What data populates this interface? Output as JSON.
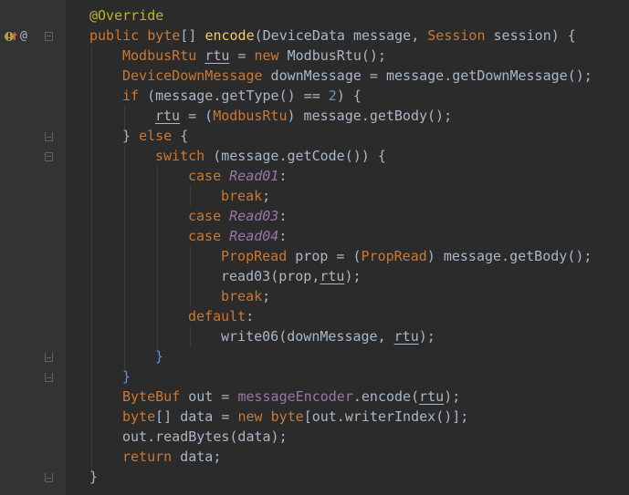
{
  "gutter": {
    "implements_icon": "implements-method-icon",
    "override_icon": "@"
  },
  "code": {
    "l0": {
      "annotation": "@Override"
    },
    "l1": {
      "t1": "public byte",
      "t2": "[] ",
      "t3": "encode",
      "t4": "(DeviceData message, ",
      "t5": "Session",
      "t6": " session) {"
    },
    "l2": {
      "t1": "ModbusRtu",
      "t2": " ",
      "t3": "rtu",
      "t4": " = ",
      "t5": "new",
      "t6": " ModbusRtu",
      "t7": "();"
    },
    "l3": {
      "t1": "DeviceDownMessage",
      "t2": " downMessage = message.",
      "t3": "getDownMessage",
      "t4": "();"
    },
    "l4": {
      "t1": "if",
      "t2": " (message.",
      "t3": "getType",
      "t4": "() == ",
      "t5": "2",
      "t6": ") {"
    },
    "l5": {
      "t1": "rtu",
      "t2": " = (",
      "t3": "ModbusRtu",
      "t4": ") message.",
      "t5": "getBody",
      "t6": "();"
    },
    "l6": {
      "t1": "} ",
      "t2": "else",
      "t3": " {"
    },
    "l7": {
      "t1": "switch",
      "t2": " (message.",
      "t3": "getCode",
      "t4": "()) {"
    },
    "l8": {
      "t1": "case",
      "t2": " ",
      "t3": "Read01",
      "t4": ":"
    },
    "l9": {
      "t1": "break",
      "t2": ";"
    },
    "l10": {
      "t1": "case",
      "t2": " ",
      "t3": "Read03",
      "t4": ":"
    },
    "l11": {
      "t1": "case",
      "t2": " ",
      "t3": "Read04",
      "t4": ":"
    },
    "l12": {
      "t1": "PropRead",
      "t2": " prop = (",
      "t3": "PropRead",
      "t4": ") message.",
      "t5": "getBody",
      "t6": "();"
    },
    "l13": {
      "t1": "read03",
      "t2": "(prop,",
      "t3": "rtu",
      "t4": ");"
    },
    "l14": {
      "t1": "break",
      "t2": ";"
    },
    "l15": {
      "t1": "default",
      "t2": ":"
    },
    "l16": {
      "t1": "write06",
      "t2": "(downMessage, ",
      "t3": "rtu",
      "t4": ");"
    },
    "l17": {
      "t1": "}"
    },
    "l18": {
      "t1": "}"
    },
    "l19": {
      "t1": "ByteBuf",
      "t2": " out = ",
      "t3": "messageEncoder",
      "t4": ".",
      "t5": "encode",
      "t6": "(",
      "t7": "rtu",
      "t8": ");"
    },
    "l20": {
      "t1": "byte",
      "t2": "[] data = ",
      "t3": "new",
      "t4": " ",
      "t5": "byte",
      "t6": "[out.",
      "t7": "writerIndex",
      "t8": "()];"
    },
    "l21": {
      "t1": "out.",
      "t2": "readBytes",
      "t3": "(data);"
    },
    "l22": {
      "t1": "return",
      "t2": " data;"
    },
    "l23": {
      "t1": "}"
    }
  }
}
